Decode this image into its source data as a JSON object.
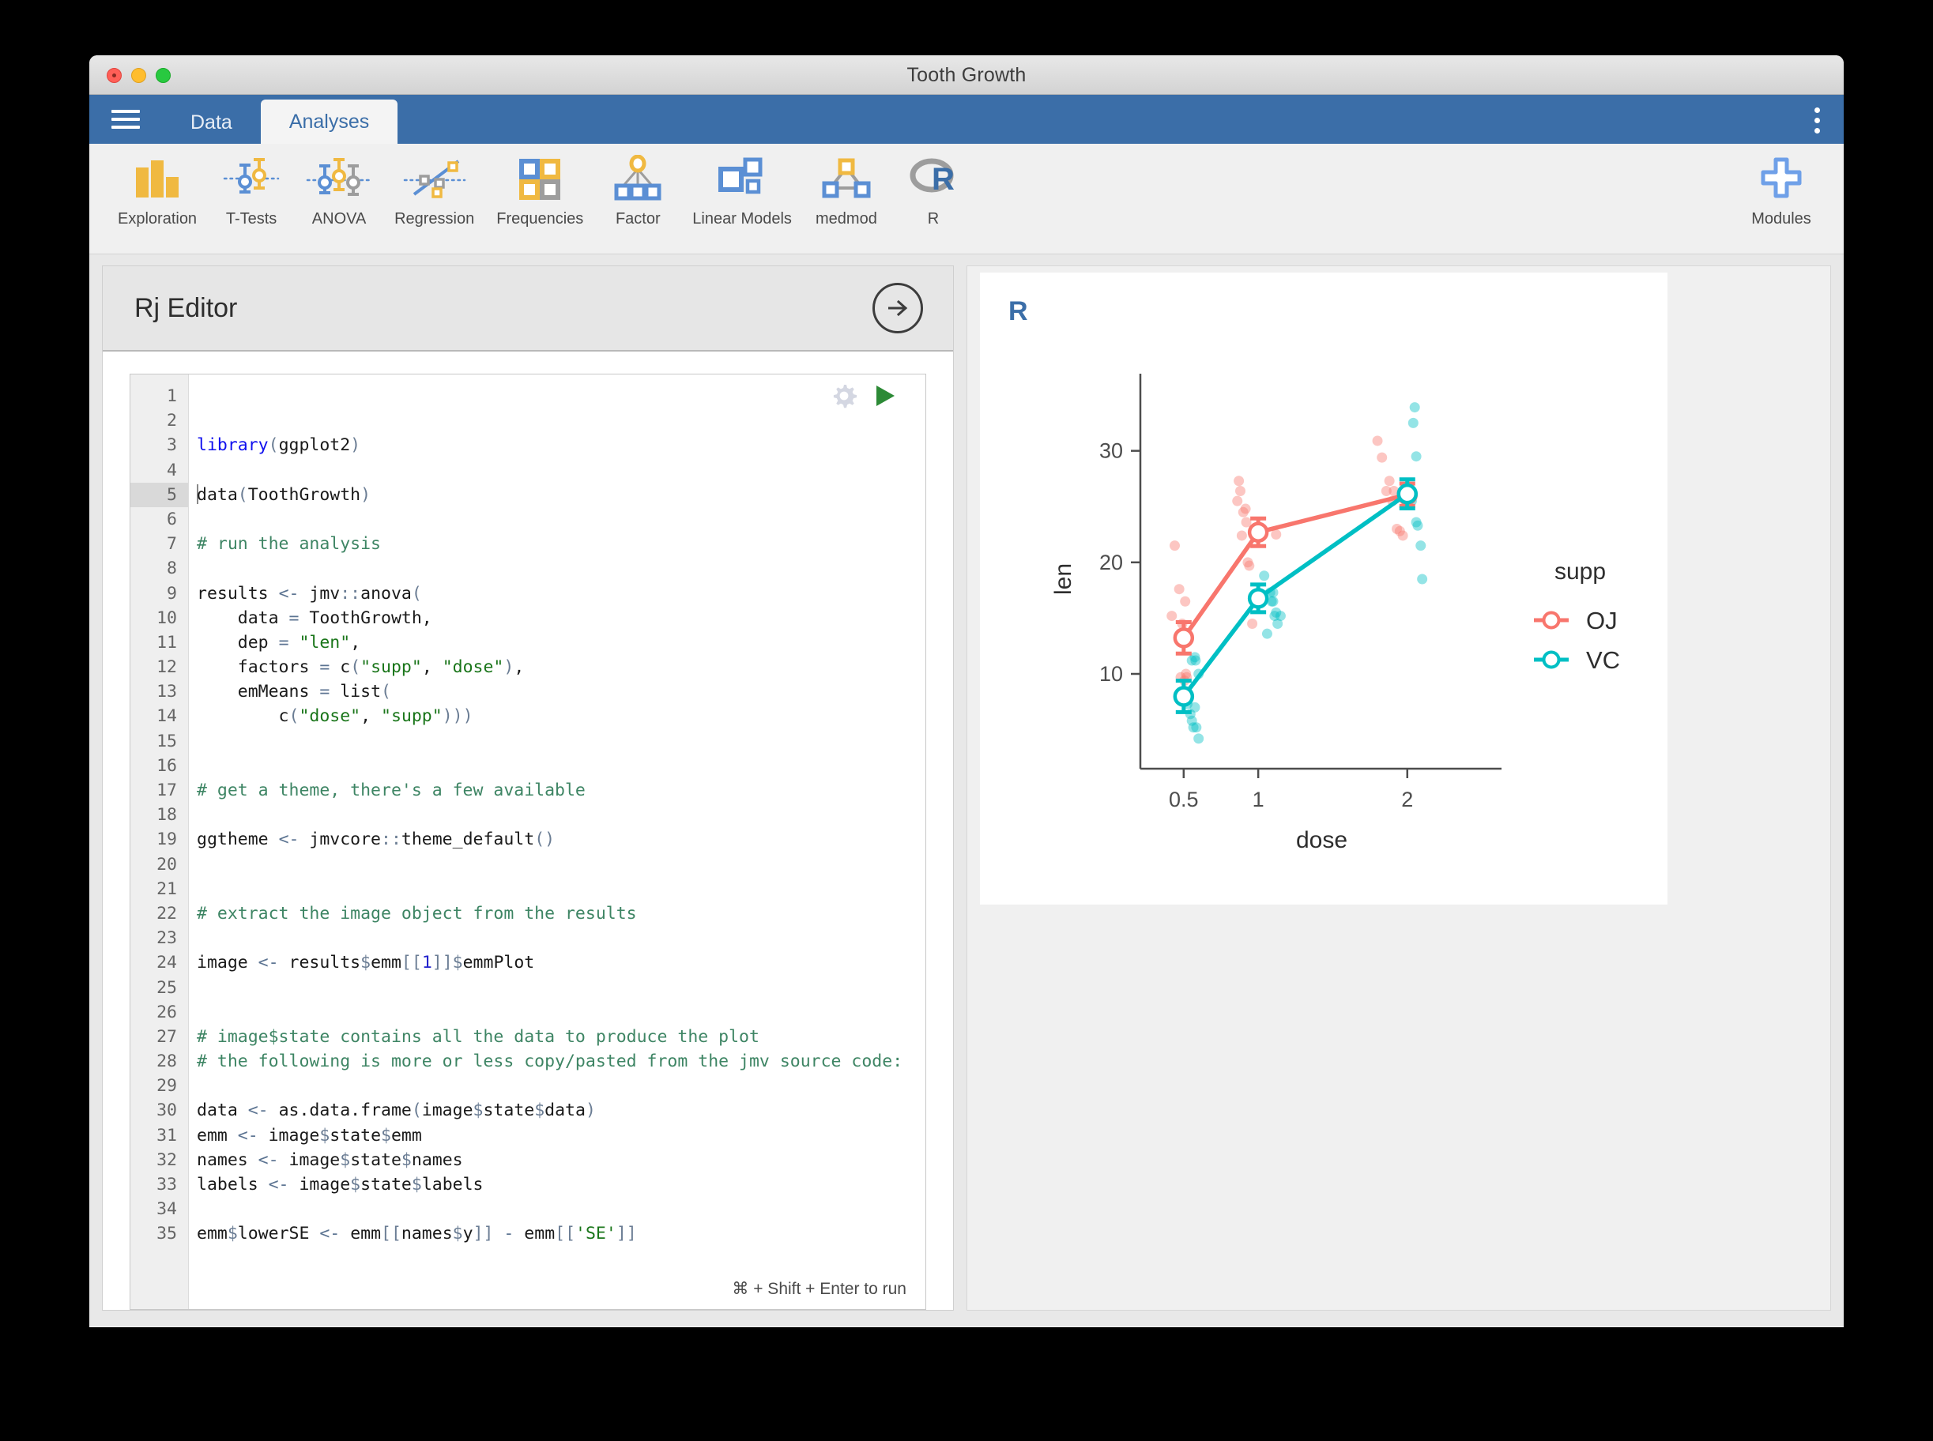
{
  "window": {
    "title": "Tooth Growth",
    "traffic_lights": [
      "close-red",
      "minimize-yellow",
      "zoom-green"
    ]
  },
  "tabbar": {
    "menu_icon": "hamburger-icon",
    "tabs": [
      {
        "label": "Data",
        "active": false
      },
      {
        "label": "Analyses",
        "active": true
      }
    ],
    "overflow_icon": "kebab-menu-icon"
  },
  "ribbon": {
    "items": [
      {
        "label": "Exploration",
        "icon": "bar-chart-icon"
      },
      {
        "label": "T-Tests",
        "icon": "two-errorbars-icon"
      },
      {
        "label": "ANOVA",
        "icon": "three-errorbars-icon"
      },
      {
        "label": "Regression",
        "icon": "scatter-line-icon"
      },
      {
        "label": "Frequencies",
        "icon": "four-squares-icon"
      },
      {
        "label": "Factor",
        "icon": "factor-tree-icon"
      },
      {
        "label": "Linear Models",
        "icon": "squares-sizes-icon"
      },
      {
        "label": "medmod",
        "icon": "mediation-triangle-icon"
      },
      {
        "label": "R",
        "icon": "r-logo-icon"
      }
    ],
    "modules": {
      "label": "Modules",
      "icon": "plus-icon"
    }
  },
  "options_panel": {
    "title": "Rj Editor",
    "collapse_icon": "arrow-right-circle-icon",
    "settings_icon": "gear-icon",
    "run_icon": "play-icon",
    "run_hint": "⌘ + Shift + Enter to run",
    "cursor_line": 5,
    "code_lines": [
      {
        "n": 1,
        "tokens": []
      },
      {
        "n": 2,
        "tokens": []
      },
      {
        "n": 3,
        "tokens": [
          {
            "t": "library",
            "c": "kw"
          },
          {
            "t": "(",
            "c": "pun"
          },
          {
            "t": "ggplot2",
            "c": ""
          },
          {
            "t": ")",
            "c": "pun"
          }
        ]
      },
      {
        "n": 4,
        "tokens": []
      },
      {
        "n": 5,
        "tokens": [
          {
            "t": "data",
            "c": ""
          },
          {
            "t": "(",
            "c": "pun"
          },
          {
            "t": "ToothGrowth",
            "c": ""
          },
          {
            "t": ")",
            "c": "pun"
          }
        ]
      },
      {
        "n": 6,
        "tokens": []
      },
      {
        "n": 7,
        "tokens": [
          {
            "t": "# run the analysis",
            "c": "cmt"
          }
        ]
      },
      {
        "n": 8,
        "tokens": []
      },
      {
        "n": 9,
        "tokens": [
          {
            "t": "results ",
            "c": ""
          },
          {
            "t": "<-",
            "c": "op"
          },
          {
            "t": " jmv",
            "c": ""
          },
          {
            "t": "::",
            "c": "pun"
          },
          {
            "t": "anova",
            "c": ""
          },
          {
            "t": "(",
            "c": "pun"
          }
        ]
      },
      {
        "n": 10,
        "tokens": [
          {
            "t": "    data ",
            "c": ""
          },
          {
            "t": "=",
            "c": "op"
          },
          {
            "t": " ToothGrowth,",
            "c": ""
          }
        ]
      },
      {
        "n": 11,
        "tokens": [
          {
            "t": "    dep ",
            "c": ""
          },
          {
            "t": "=",
            "c": "op"
          },
          {
            "t": " ",
            "c": ""
          },
          {
            "t": "\"len\"",
            "c": "str"
          },
          {
            "t": ",",
            "c": ""
          }
        ]
      },
      {
        "n": 12,
        "tokens": [
          {
            "t": "    factors ",
            "c": ""
          },
          {
            "t": "=",
            "c": "op"
          },
          {
            "t": " c",
            "c": ""
          },
          {
            "t": "(",
            "c": "pun"
          },
          {
            "t": "\"supp\"",
            "c": "str"
          },
          {
            "t": ", ",
            "c": ""
          },
          {
            "t": "\"dose\"",
            "c": "str"
          },
          {
            "t": ")",
            "c": "pun"
          },
          {
            "t": ",",
            "c": ""
          }
        ]
      },
      {
        "n": 13,
        "tokens": [
          {
            "t": "    emMeans ",
            "c": ""
          },
          {
            "t": "=",
            "c": "op"
          },
          {
            "t": " list",
            "c": ""
          },
          {
            "t": "(",
            "c": "pun"
          }
        ]
      },
      {
        "n": 14,
        "tokens": [
          {
            "t": "        c",
            "c": ""
          },
          {
            "t": "(",
            "c": "pun"
          },
          {
            "t": "\"dose\"",
            "c": "str"
          },
          {
            "t": ", ",
            "c": ""
          },
          {
            "t": "\"supp\"",
            "c": "str"
          },
          {
            "t": ")))",
            "c": "pun"
          }
        ]
      },
      {
        "n": 15,
        "tokens": []
      },
      {
        "n": 16,
        "tokens": []
      },
      {
        "n": 17,
        "tokens": [
          {
            "t": "# get a theme, there's a few available",
            "c": "cmt"
          }
        ]
      },
      {
        "n": 18,
        "tokens": []
      },
      {
        "n": 19,
        "tokens": [
          {
            "t": "ggtheme ",
            "c": ""
          },
          {
            "t": "<-",
            "c": "op"
          },
          {
            "t": " jmvcore",
            "c": ""
          },
          {
            "t": "::",
            "c": "pun"
          },
          {
            "t": "theme_default",
            "c": ""
          },
          {
            "t": "()",
            "c": "pun"
          }
        ]
      },
      {
        "n": 20,
        "tokens": []
      },
      {
        "n": 21,
        "tokens": []
      },
      {
        "n": 22,
        "tokens": [
          {
            "t": "# extract the image object from the results",
            "c": "cmt"
          }
        ]
      },
      {
        "n": 23,
        "tokens": []
      },
      {
        "n": 24,
        "tokens": [
          {
            "t": "image ",
            "c": ""
          },
          {
            "t": "<-",
            "c": "op"
          },
          {
            "t": " results",
            "c": ""
          },
          {
            "t": "$",
            "c": "pun"
          },
          {
            "t": "emm",
            "c": ""
          },
          {
            "t": "[[",
            "c": "pun"
          },
          {
            "t": "1",
            "c": "num"
          },
          {
            "t": "]]",
            "c": "pun"
          },
          {
            "t": "$",
            "c": "pun"
          },
          {
            "t": "emmPlot",
            "c": ""
          }
        ]
      },
      {
        "n": 25,
        "tokens": []
      },
      {
        "n": 26,
        "tokens": []
      },
      {
        "n": 27,
        "tokens": [
          {
            "t": "# image$state contains all the data to produce the plot",
            "c": "cmt"
          }
        ]
      },
      {
        "n": 28,
        "tokens": [
          {
            "t": "# the following is more or less copy/pasted from the jmv source code:",
            "c": "cmt"
          }
        ]
      },
      {
        "n": 29,
        "tokens": []
      },
      {
        "n": 30,
        "tokens": [
          {
            "t": "data ",
            "c": ""
          },
          {
            "t": "<-",
            "c": "op"
          },
          {
            "t": " as.data.frame",
            "c": ""
          },
          {
            "t": "(",
            "c": "pun"
          },
          {
            "t": "image",
            "c": ""
          },
          {
            "t": "$",
            "c": "pun"
          },
          {
            "t": "state",
            "c": ""
          },
          {
            "t": "$",
            "c": "pun"
          },
          {
            "t": "data",
            "c": ""
          },
          {
            "t": ")",
            "c": "pun"
          }
        ]
      },
      {
        "n": 31,
        "tokens": [
          {
            "t": "emm ",
            "c": ""
          },
          {
            "t": "<-",
            "c": "op"
          },
          {
            "t": " image",
            "c": ""
          },
          {
            "t": "$",
            "c": "pun"
          },
          {
            "t": "state",
            "c": ""
          },
          {
            "t": "$",
            "c": "pun"
          },
          {
            "t": "emm",
            "c": ""
          }
        ]
      },
      {
        "n": 32,
        "tokens": [
          {
            "t": "names ",
            "c": ""
          },
          {
            "t": "<-",
            "c": "op"
          },
          {
            "t": " image",
            "c": ""
          },
          {
            "t": "$",
            "c": "pun"
          },
          {
            "t": "state",
            "c": ""
          },
          {
            "t": "$",
            "c": "pun"
          },
          {
            "t": "names",
            "c": ""
          }
        ]
      },
      {
        "n": 33,
        "tokens": [
          {
            "t": "labels ",
            "c": ""
          },
          {
            "t": "<-",
            "c": "op"
          },
          {
            "t": " image",
            "c": ""
          },
          {
            "t": "$",
            "c": "pun"
          },
          {
            "t": "state",
            "c": ""
          },
          {
            "t": "$",
            "c": "pun"
          },
          {
            "t": "labels",
            "c": ""
          }
        ]
      },
      {
        "n": 34,
        "tokens": []
      },
      {
        "n": 35,
        "tokens": [
          {
            "t": "emm",
            "c": ""
          },
          {
            "t": "$",
            "c": "pun"
          },
          {
            "t": "lowerSE ",
            "c": ""
          },
          {
            "t": "<-",
            "c": "op"
          },
          {
            "t": " emm",
            "c": ""
          },
          {
            "t": "[[",
            "c": "pun"
          },
          {
            "t": "names",
            "c": ""
          },
          {
            "t": "$",
            "c": "pun"
          },
          {
            "t": "y",
            "c": ""
          },
          {
            "t": "]]",
            "c": "pun"
          },
          {
            "t": " ",
            "c": ""
          },
          {
            "t": "-",
            "c": "op"
          },
          {
            "t": " emm",
            "c": ""
          },
          {
            "t": "[[",
            "c": "pun"
          },
          {
            "t": "'SE'",
            "c": "str"
          },
          {
            "t": "]]",
            "c": "pun"
          }
        ]
      }
    ]
  },
  "results": {
    "heading": "R"
  },
  "chart_data": {
    "type": "line",
    "title": "",
    "xlabel": "dose",
    "ylabel": "len",
    "x_categories": [
      "0.5",
      "1",
      "2"
    ],
    "xlim": [
      0.22,
      2.42
    ],
    "ylim": [
      1.5,
      35.5
    ],
    "y_ticks": [
      10,
      20,
      30
    ],
    "grid": false,
    "legend": {
      "title": "supp",
      "position": "right",
      "entries": [
        {
          "label": "OJ",
          "color": "#F8766D"
        },
        {
          "label": "VC",
          "color": "#00BFC4"
        }
      ]
    },
    "series": [
      {
        "name": "OJ",
        "color": "#F8766D",
        "x": [
          0.5,
          1,
          2
        ],
        "means": [
          13.23,
          22.7,
          26.06
        ],
        "se": [
          1.41,
          1.24,
          1.0
        ],
        "lowerSE": [
          11.82,
          21.46,
          25.06
        ],
        "upperSE": [
          14.64,
          23.94,
          27.06
        ]
      },
      {
        "name": "VC",
        "color": "#00BFC4",
        "x": [
          0.5,
          1,
          2
        ],
        "means": [
          7.98,
          16.77,
          26.14
        ],
        "se": [
          1.41,
          1.24,
          1.3
        ],
        "lowerSE": [
          6.57,
          15.53,
          24.84
        ],
        "upperSE": [
          9.39,
          18.01,
          27.44
        ]
      }
    ],
    "raw_points": {
      "OJ": [
        [
          0.42,
          15.2
        ],
        [
          0.44,
          21.5
        ],
        [
          0.47,
          17.6
        ],
        [
          0.48,
          9.7
        ],
        [
          0.49,
          14.5
        ],
        [
          0.505,
          9.4
        ],
        [
          0.51,
          16.5
        ],
        [
          0.515,
          10.0
        ],
        [
          0.52,
          9.7
        ],
        [
          0.53,
          8.2
        ],
        [
          0.86,
          25.5
        ],
        [
          0.87,
          27.3
        ],
        [
          0.88,
          26.4
        ],
        [
          0.89,
          22.4
        ],
        [
          0.9,
          24.5
        ],
        [
          0.915,
          24.8
        ],
        [
          0.92,
          23.6
        ],
        [
          0.93,
          20.0
        ],
        [
          0.94,
          19.7
        ],
        [
          0.96,
          14.5
        ],
        [
          1.12,
          22.5
        ],
        [
          1.8,
          30.9
        ],
        [
          1.83,
          29.4
        ],
        [
          1.86,
          26.4
        ],
        [
          1.88,
          27.3
        ],
        [
          1.9,
          25.5
        ],
        [
          1.91,
          26.4
        ],
        [
          1.93,
          23.0
        ],
        [
          1.95,
          22.8
        ],
        [
          1.97,
          22.4
        ],
        [
          1.99,
          25.5
        ]
      ],
      "VC": [
        [
          0.555,
          11.2
        ],
        [
          0.575,
          11.5
        ],
        [
          0.58,
          11.2
        ],
        [
          0.6,
          10.0
        ],
        [
          0.525,
          7.3
        ],
        [
          0.545,
          6.4
        ],
        [
          0.555,
          5.8
        ],
        [
          0.575,
          7.0
        ],
        [
          0.585,
          5.2
        ],
        [
          0.6,
          4.2
        ],
        [
          0.565,
          5.2
        ],
        [
          1.04,
          18.8
        ],
        [
          1.08,
          17.3
        ],
        [
          1.09,
          16.5
        ],
        [
          1.1,
          16.5
        ],
        [
          1.11,
          15.2
        ],
        [
          1.12,
          15.5
        ],
        [
          1.13,
          14.5
        ],
        [
          1.15,
          15.2
        ],
        [
          1.06,
          13.6
        ],
        [
          1.1,
          17.3
        ],
        [
          2.05,
          33.9
        ],
        [
          2.04,
          32.5
        ],
        [
          2.06,
          29.5
        ],
        [
          2.02,
          26.4
        ],
        [
          2.03,
          25.5
        ],
        [
          2.07,
          23.3
        ],
        [
          2.06,
          23.6
        ],
        [
          2.09,
          21.5
        ],
        [
          2.1,
          18.5
        ],
        [
          2.01,
          26.4
        ]
      ]
    }
  }
}
